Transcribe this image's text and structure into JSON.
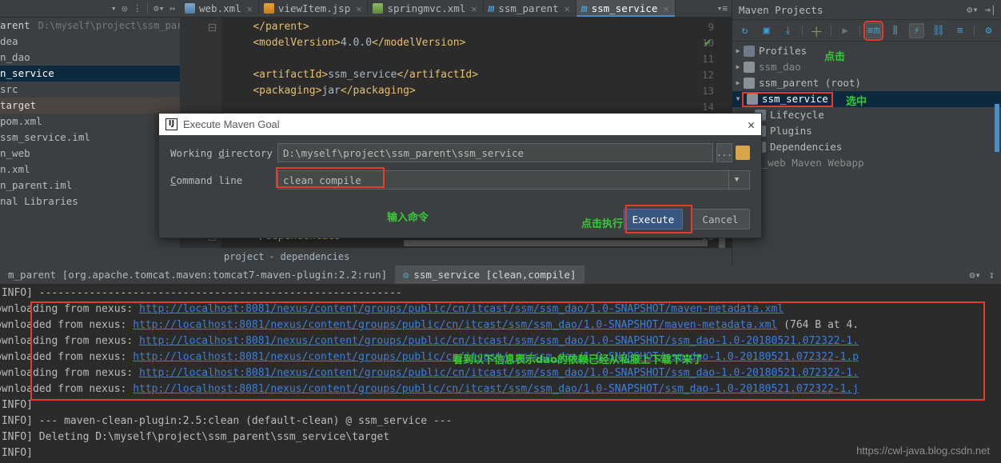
{
  "toolbar": {
    "icons": [
      "chevron-down",
      "locate",
      "collapse-all",
      "settings",
      "hide"
    ]
  },
  "project_tree": {
    "rows": [
      {
        "label": "arent",
        "path": "D:\\myself\\project\\ssm_pare",
        "state": "root"
      },
      {
        "label": "dea",
        "state": "normal"
      },
      {
        "label": "n_dao",
        "state": "normal"
      },
      {
        "label": "n_service",
        "state": "selected"
      },
      {
        "label": "src",
        "state": "normal"
      },
      {
        "label": "target",
        "state": "hilite"
      },
      {
        "label": "pom.xml",
        "state": "normal"
      },
      {
        "label": "ssm_service.iml",
        "state": "normal"
      },
      {
        "label": "n_web",
        "state": "normal"
      },
      {
        "label": "n.xml",
        "state": "normal"
      },
      {
        "label": "n_parent.iml",
        "state": "normal"
      },
      {
        "label": "nal Libraries",
        "state": "normal"
      }
    ]
  },
  "editor": {
    "tabs": [
      {
        "label": "web.xml",
        "icon": "xml-file-icon",
        "active": false
      },
      {
        "label": "viewItem.jsp",
        "icon": "jsp-file-icon",
        "active": false
      },
      {
        "label": "springmvc.xml",
        "icon": "spring-xml-file-icon",
        "active": false
      },
      {
        "label": "ssm_parent",
        "icon": "maven-pom-icon",
        "active": false
      },
      {
        "label": "ssm_service",
        "icon": "maven-pom-icon",
        "active": true
      }
    ],
    "lines": [
      {
        "no": "9",
        "text": "    </parent>",
        "fold": true
      },
      {
        "no": "10",
        "text": "    <modelVersion>4.0.0</modelVersion>",
        "fold": false
      },
      {
        "no": "11",
        "text": "",
        "fold": false
      },
      {
        "no": "12",
        "text": "    <artifactId>ssm_service</artifactId>",
        "fold": false
      },
      {
        "no": "13",
        "text": "    <packaging>jar</packaging>",
        "fold": false
      },
      {
        "no": "14",
        "text": "",
        "fold": false
      },
      {
        "no": "23",
        "text": "    </dependencies>",
        "fold": true
      }
    ],
    "breadcrumb": [
      "project",
      "dependencies"
    ],
    "inspection_status": "ok-check-icon"
  },
  "maven_panel": {
    "title": "Maven Projects",
    "header_icons": [
      "gear-dropdown-icon",
      "hide-panel-icon"
    ],
    "toolbar_buttons": [
      {
        "name": "reimport-icon",
        "highlight": false,
        "boxed": false
      },
      {
        "name": "generate-sources-icon",
        "highlight": false,
        "boxed": false
      },
      {
        "name": "download-sources-icon",
        "highlight": false,
        "boxed": false
      },
      {
        "name": "add-maven-project-icon",
        "highlight": false,
        "boxed": false
      },
      {
        "name": "run-icon",
        "highlight": false,
        "boxed": false
      },
      {
        "name": "execute-maven-goal-icon",
        "highlight": true,
        "boxed": true
      },
      {
        "name": "toggle-offline-icon",
        "highlight": false,
        "boxed": false
      },
      {
        "name": "toggle-skip-tests-icon",
        "highlight": false,
        "boxed": true
      },
      {
        "name": "show-dependencies-icon",
        "highlight": false,
        "boxed": false
      },
      {
        "name": "collapse-all-icon",
        "highlight": false,
        "boxed": false
      },
      {
        "name": "maven-settings-icon",
        "highlight": false,
        "boxed": false
      }
    ],
    "tree": [
      {
        "label": "Profiles",
        "arrow": "right",
        "icon": "profiles-folder-icon",
        "indent": 0,
        "state": "normal",
        "boxed": false
      },
      {
        "label": "ssm_dao",
        "arrow": "right",
        "icon": "maven-module-icon",
        "indent": 0,
        "state": "dim",
        "boxed": false
      },
      {
        "label": "ssm_parent (root)",
        "arrow": "right",
        "icon": "maven-module-icon",
        "indent": 0,
        "state": "normal",
        "boxed": false
      },
      {
        "label": "ssm_service",
        "arrow": "down",
        "icon": "maven-module-icon",
        "indent": 0,
        "state": "selected",
        "boxed": true
      },
      {
        "label": "Lifecycle",
        "arrow": "none",
        "icon": "lifecycle-folder-icon",
        "indent": 1,
        "state": "normal",
        "boxed": false
      },
      {
        "label": "Plugins",
        "arrow": "none",
        "icon": "plugins-folder-icon",
        "indent": 1,
        "state": "normal",
        "boxed": false
      },
      {
        "label": "Dependencies",
        "arrow": "none",
        "icon": "dependencies-folder-icon",
        "indent": 1,
        "state": "normal",
        "boxed": false
      },
      {
        "label": "ssm_web Maven Webapp",
        "arrow": "none",
        "icon": "none",
        "indent": 0,
        "state": "dim",
        "boxed": false
      }
    ],
    "annotations": {
      "click": "点击",
      "selected": "选中"
    }
  },
  "dialog": {
    "title": "Execute Maven Goal",
    "close_label": "✕",
    "working_directory_label": "Working directory",
    "working_directory_value": "D:\\myself\\project\\ssm_parent\\ssm_service",
    "browse_label": "...",
    "command_line_label": "Command line",
    "command_line_value": "clean compile",
    "execute_label": "Execute",
    "cancel_label": "Cancel",
    "annotations": {
      "input_command": "输入命令",
      "click_execute": "点击执行"
    }
  },
  "console": {
    "tabs": [
      {
        "label": "m_parent [org.apache.tomcat.maven:tomcat7-maven-plugin:2.2:run]",
        "active": false,
        "icon": "none"
      },
      {
        "label": "ssm_service [clean,compile]",
        "active": true,
        "icon": "maven-gear-icon"
      }
    ],
    "tools": [
      "gear-dropdown-icon",
      "export-icon"
    ],
    "lines": [
      {
        "prefix": "[INFO] ----------------------------------------------------------",
        "url": ""
      },
      {
        "prefix": "ownloading from nexus: ",
        "url": "http://localhost:8081/nexus/content/groups/public/cn/itcast/ssm/ssm_dao/1.0-SNAPSHOT/maven-metadata.xml",
        "suffix": ""
      },
      {
        "prefix": "ownloaded from nexus: ",
        "url": "http://localhost:8081/nexus/content/groups/public/cn/itcast/ssm/ssm_dao/1.0-SNAPSHOT/maven-metadata.xml",
        "suffix": " (764 B at 4."
      },
      {
        "prefix": "ownloading from nexus: ",
        "url": "http://localhost:8081/nexus/content/groups/public/cn/itcast/ssm/ssm_dao/1.0-SNAPSHOT/ssm_dao-1.0-20180521.072322-1.",
        "suffix": ""
      },
      {
        "prefix": "ownloaded from nexus: ",
        "url": "http://localhost:8081/nexus/content/groups/public/cn/itcast/ssm/ssm_dao/1.0-SNAPSHOT/ssm_dao-1.0-20180521.072322-1.p",
        "suffix": ""
      },
      {
        "prefix": "ownloading from nexus: ",
        "url": "http://localhost:8081/nexus/content/groups/public/cn/itcast/ssm/ssm_dao/1.0-SNAPSHOT/ssm_dao-1.0-20180521.072322-1.",
        "suffix": ""
      },
      {
        "prefix": "ownloaded from nexus: ",
        "url": "http://localhost:8081/nexus/content/groups/public/cn/itcast/ssm/ssm_dao/1.0-SNAPSHOT/ssm_dao-1.0-20180521.072322-1.j",
        "suffix": ""
      },
      {
        "prefix": "[INFO]",
        "url": ""
      },
      {
        "prefix": "[INFO] --- maven-clean-plugin:2.5:clean (default-clean) @ ssm_service ---",
        "url": ""
      },
      {
        "prefix": "[INFO] Deleting D:\\myself\\project\\ssm_parent\\ssm_service\\target",
        "url": ""
      },
      {
        "prefix": "[INFO]",
        "url": ""
      }
    ],
    "annotation": "看到以下信息表示dao的依赖已经从私服上下载下来了"
  },
  "watermark": "https://cwl-java.blog.csdn.net",
  "colors": {
    "accent_blue": "#4a9fd4",
    "highlight_red": "#e83b2e",
    "annotation_green": "#33cc33",
    "selection_blue": "#0d293e",
    "link_blue": "#3f7fd6"
  }
}
